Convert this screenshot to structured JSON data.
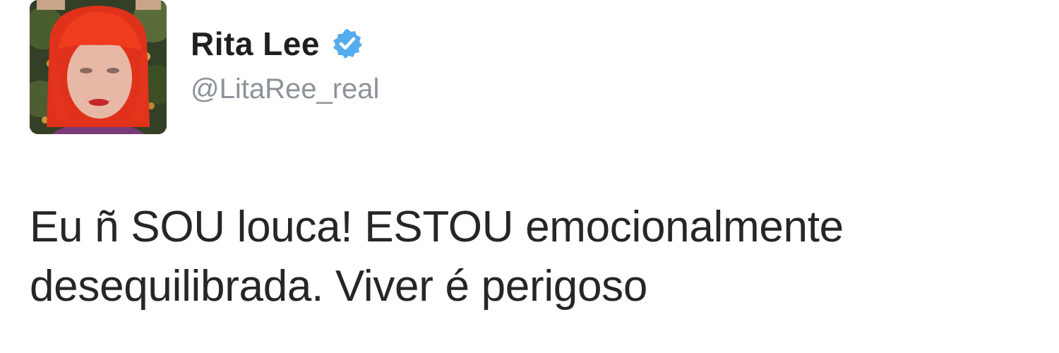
{
  "tweet": {
    "author": {
      "display_name": "Rita Lee",
      "handle": "@LitaRee_real",
      "verified": true,
      "avatar_icon": "profile-photo",
      "verified_icon": "verified-badge-icon",
      "verified_color": "#55acee"
    },
    "text_lines": [
      "Eu ñ SOU louca! ESTOU emocionalmente",
      "desequilibrada. Viver é perigoso"
    ]
  }
}
